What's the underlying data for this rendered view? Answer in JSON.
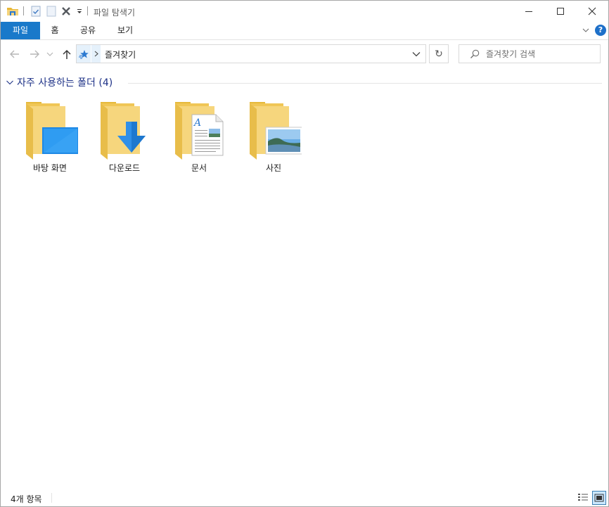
{
  "titlebar": {
    "title": "파일 탐색기",
    "quick_access": [
      "folder-icon",
      "properties-icon",
      "new-folder-icon",
      "delete-icon",
      "customize-dropdown-icon"
    ],
    "controls": [
      "minimize-icon",
      "maximize-icon",
      "close-icon"
    ]
  },
  "ribbon": {
    "tabs": [
      {
        "label": "파일",
        "active": true
      },
      {
        "label": "홈"
      },
      {
        "label": "공유"
      },
      {
        "label": "보기"
      }
    ],
    "help_label": "?"
  },
  "nav": {
    "address_text": "즐겨찾기",
    "refresh_glyph": "↻",
    "search_placeholder": "즐겨찾기 검색"
  },
  "content": {
    "group_title": "자주 사용하는 폴더 (4)",
    "folders": [
      {
        "label": "바탕 화면",
        "icon": "desktop-folder-icon"
      },
      {
        "label": "다운로드",
        "icon": "downloads-folder-icon"
      },
      {
        "label": "문서",
        "icon": "documents-folder-icon"
      },
      {
        "label": "사진",
        "icon": "pictures-folder-icon"
      }
    ]
  },
  "status": {
    "item_count": "4개 항목",
    "views": [
      "details-view-icon",
      "large-icons-view-icon"
    ],
    "active_view": "large-icons-view-icon"
  },
  "colors": {
    "accent": "#1979ca",
    "folder": "#f5d37a",
    "group_title": "#1e3287"
  }
}
